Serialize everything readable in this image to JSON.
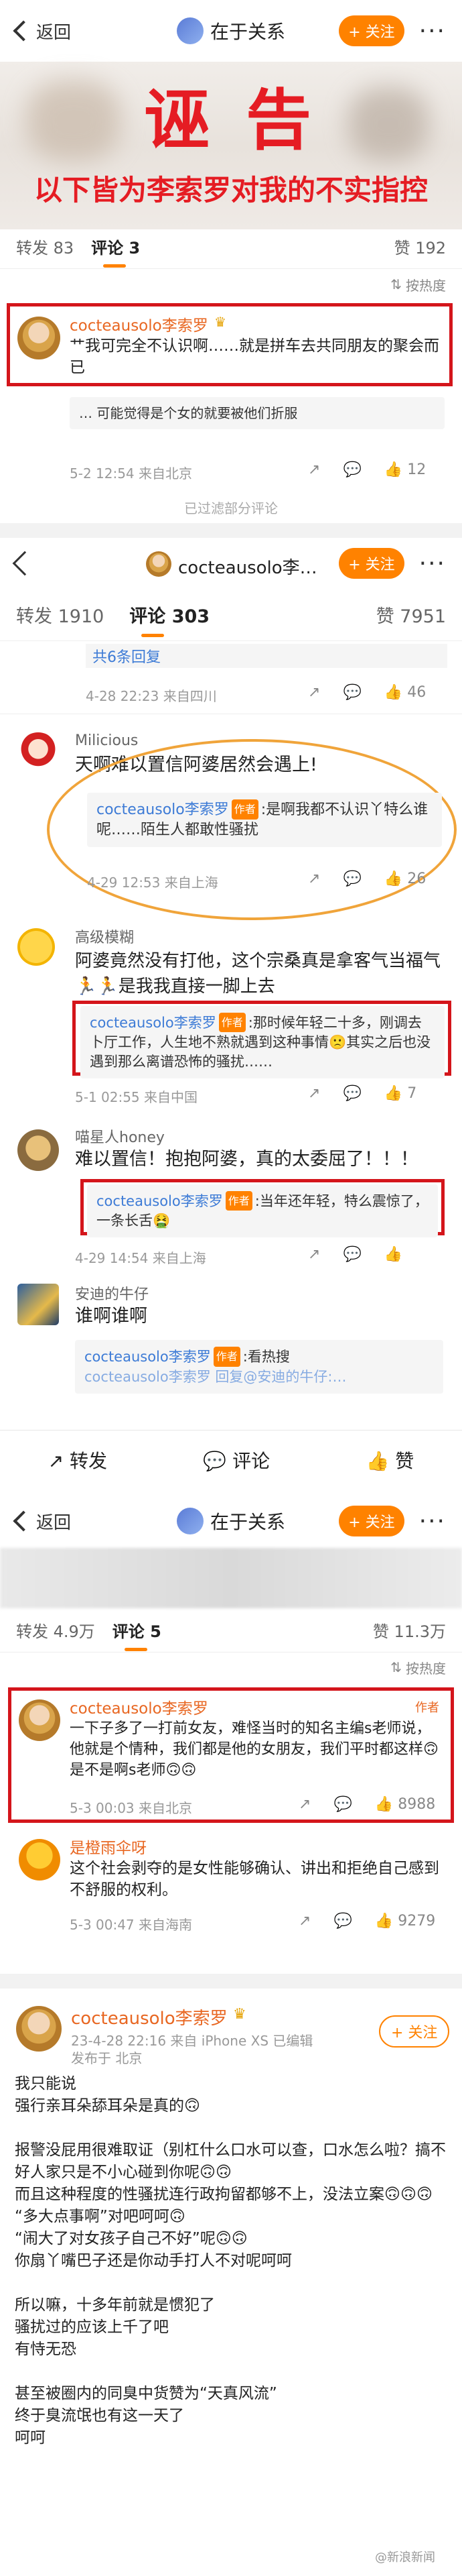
{
  "s1": {
    "back": "返回",
    "nav_title": "在于关系",
    "follow": "+ 关注",
    "more": "···",
    "big_title": "诬 告",
    "subtitle": "以下皆为李索罗对我的不实指控",
    "tab_repost": "转发 83",
    "tab_comment": "评论 3",
    "tab_like": "赞 192",
    "sort": "按热度",
    "c1_name": "cocteausolo李索罗",
    "c1_text": "艹我可完全不认识啊……就是拼车去共同朋友的聚会而已",
    "c1_reply": "… 可能觉得是个女的就要被他们折服",
    "c1_meta": "5-2 12:54 来自北京",
    "c1_likes": "12",
    "c1_reply_cnt": "",
    "expanded": "已过滤部分评论"
  },
  "s2": {
    "nav_name": "cocteausolo李…",
    "follow": "+ 关注",
    "more": "···",
    "tab_repost": "转发 1910",
    "tab_comment": "评论 303",
    "tab_like": "赞 7951",
    "top_reply": "共6条回复",
    "top_meta": "4-28 22:23 来自四川",
    "top_likes": "46",
    "u1_name": "Milicious",
    "u1_text": "天啊难以置信阿婆居然会遇上!",
    "u1_quote_name": "cocteausolo李索罗",
    "u1_quote_tag": "作者",
    "u1_quote": ":是啊我都不认识丫特么谁呢……陌生人都敢性骚扰",
    "u1_meta": "4-29 12:53 来自上海",
    "u1_likes": "26",
    "u2_name": "高级模糊",
    "u2_text": "阿婆竟然没有打他，这个宗桑真是拿客气当福气🏃🏃是我我直接一脚上去",
    "u2_quote_name": "cocteausolo李索罗",
    "u2_quote_tag": "作者",
    "u2_quote": ":那时候年轻二十多，刚调去卜厅工作，人生地不熟就遇到这种事情🙁其实之后也没遇到那么离谱恐怖的骚扰……",
    "u2_meta": "5-1 02:55 来自中国",
    "u2_likes": "7",
    "u3_name": "喵星人honey",
    "u3_text": "难以置信！抱抱阿婆，真的太委屈了！！！",
    "u3_quote_name": "cocteausolo李索罗",
    "u3_quote_tag": "作者",
    "u3_quote": ":当年还年轻，特么震惊了，一条长舌🤮",
    "u3_meta": "4-29 14:54 来自上海",
    "u3_likes": "",
    "u4_name": "安迪的牛仔",
    "u4_text": "谁啊谁啊",
    "u4_quote_name": "cocteausolo李索罗",
    "u4_quote_tag": "作者",
    "u4_quote": ":看热搜",
    "u4_quote2": "cocteausolo李索罗 回复@安迪的牛仔:…",
    "bar_repost": "转发",
    "bar_comment": "评论",
    "bar_like": "赞"
  },
  "s3": {
    "back": "返回",
    "nav_title": "在于关系",
    "follow": "+ 关注",
    "more": "···",
    "tab_repost": "转发 4.9万",
    "tab_comment": "评论 5",
    "tab_like": "赞 11.3万",
    "sort": "按热度",
    "c1_name": "cocteausolo李索罗",
    "c1_badge": "作者",
    "c1_text": "一下子多了一打前女友，难怪当时的知名主编s老师说，他就是个情种，我们都是他的女朋友，我们平时都这样🙃是不是啊s老师🙃🙃",
    "c1_meta": "5-3 00:03 来自北京",
    "c1_likes": "8988",
    "c2_name": "是橙雨伞呀",
    "c2_text": "这个社会剥夺的是女性能够确认、讲出和拒绝自己感到不舒服的权利。",
    "c2_meta": "5-3 00:47 来自海南",
    "c2_likes": "9279"
  },
  "s4": {
    "name": "cocteausolo李索罗",
    "follow": "+ 关注",
    "meta": "23-4-28 22:16 来自 iPhone XS 已编辑",
    "loc": "发布于 北京",
    "lines": [
      "我只能说",
      "强行亲耳朵舔耳朵是真的🙃",
      "",
      "报警没屁用很难取证（别杠什么口水可以查，口水怎么啦？搞不好人家只是不小心碰到你呢🙃🙃",
      "而且这种程度的性骚扰连行政拘留都够不上，没法立案🙃🙃🙃",
      "“多大点事啊”对吧呵呵🙃",
      "“闹大了对女孩子自己不好”呢🙃🙃",
      "你扇丫嘴巴子还是你动手打人不对呢呵呵",
      "",
      "所以嘛，十多年前就是惯犯了",
      "骚扰过的应该上千了吧",
      "有恃无恐",
      "",
      "甚至被圈内的同臭中货赞为“天真风流”",
      "终于臭流氓也有这一天了",
      "呵呵"
    ],
    "watermark": "@新浪新闻"
  },
  "colors": {
    "accent": "#ff8200",
    "red": "#d4151b",
    "name": "#e86722",
    "link": "#3d7bd6"
  }
}
